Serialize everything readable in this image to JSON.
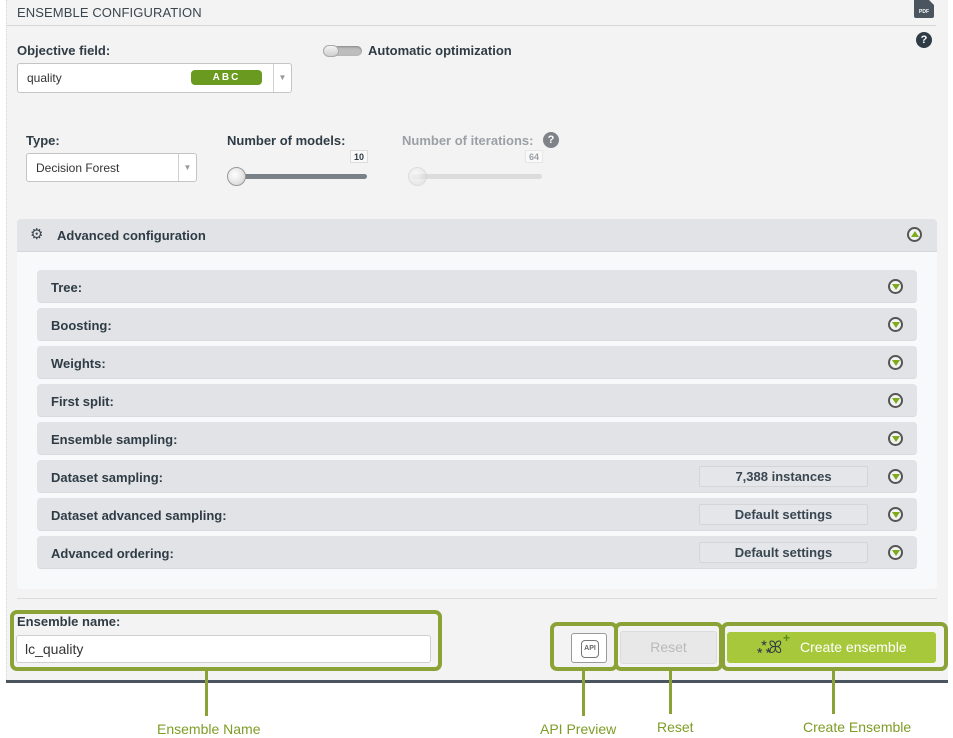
{
  "header": {
    "title": "ENSEMBLE CONFIGURATION",
    "pdf_icon_label": "PDF",
    "help_icon": "?"
  },
  "objective": {
    "label": "Objective field:",
    "value": "quality",
    "type_badge": "ABC",
    "badge_color": "#6a9a1f"
  },
  "auto_opt": {
    "label": "Automatic optimization",
    "enabled": false
  },
  "type": {
    "label": "Type:",
    "value": "Decision Forest"
  },
  "num_models": {
    "label": "Number of models:",
    "value": "10",
    "position_fraction": 0.0
  },
  "num_iterations": {
    "label": "Number of iterations:",
    "value": "64",
    "disabled": true,
    "position_fraction": 0.0,
    "help_icon": "?"
  },
  "advanced": {
    "title": "Advanced configuration",
    "expanded": true,
    "rows": [
      {
        "label": "Tree:",
        "value": null
      },
      {
        "label": "Boosting:",
        "value": null
      },
      {
        "label": "Weights:",
        "value": null
      },
      {
        "label": "First split:",
        "value": null
      },
      {
        "label": "Ensemble sampling:",
        "value": null
      },
      {
        "label": "Dataset sampling:",
        "value": "7,388 instances"
      },
      {
        "label": "Dataset advanced sampling:",
        "value": "Default settings"
      },
      {
        "label": "Advanced ordering:",
        "value": "Default settings"
      }
    ]
  },
  "ensemble_name": {
    "label": "Ensemble name:",
    "value": "lc_quality"
  },
  "buttons": {
    "api_label": "API",
    "reset_label": "Reset",
    "create_label": "Create ensemble"
  },
  "callouts": {
    "ensemble_name": "Ensemble Name",
    "api_preview": "API Preview",
    "reset": "Reset",
    "create_ensemble": "Create Ensemble"
  },
  "colors": {
    "accent": "#a7c83a",
    "highlight": "#8ba336",
    "callout_text": "#7f9c26"
  }
}
